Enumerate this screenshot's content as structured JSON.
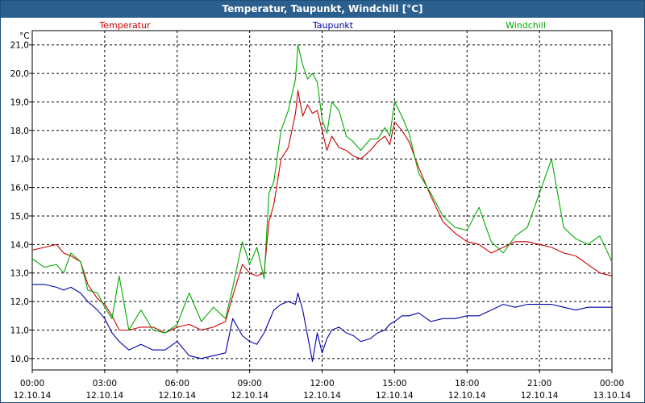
{
  "window": {
    "title": "Temperatur, Taupunkt, Windchill [°C]"
  },
  "colors": {
    "titlebar": "#2b5f8e",
    "Temperatur": "#cc0000",
    "Taupunkt": "#0000aa",
    "Windchill": "#00aa00",
    "grid": "#000000"
  },
  "chart_data": {
    "type": "line",
    "title": "Temperatur, Taupunkt, Windchill [°C]",
    "ylabel": "°C",
    "ylim": [
      9.6,
      21.5
    ],
    "xlim": [
      0,
      24
    ],
    "grid": true,
    "legend": "top",
    "y_ticks": [
      "10,0",
      "11,0",
      "12,0",
      "13,0",
      "14,0",
      "15,0",
      "16,0",
      "17,0",
      "18,0",
      "19,0",
      "20,0",
      "21,0"
    ],
    "x_ticks": [
      {
        "time": "00:00",
        "date": "12.10.14"
      },
      {
        "time": "03:00",
        "date": "12.10.14"
      },
      {
        "time": "06:00",
        "date": "12.10.14"
      },
      {
        "time": "09:00",
        "date": "12.10.14"
      },
      {
        "time": "12:00",
        "date": "12.10.14"
      },
      {
        "time": "15:00",
        "date": "12.10.14"
      },
      {
        "time": "18:00",
        "date": "12.10.14"
      },
      {
        "time": "21:00",
        "date": "12.10.14"
      },
      {
        "time": "00:00",
        "date": "13.10.14"
      }
    ],
    "series": [
      {
        "name": "Temperatur",
        "x": [
          0,
          0.5,
          1,
          1.3,
          1.6,
          2,
          2.3,
          2.7,
          3,
          3.3,
          3.6,
          4,
          4.5,
          5,
          5.5,
          6,
          6.5,
          7,
          7.5,
          8,
          8.3,
          8.7,
          9,
          9.3,
          9.6,
          9.8,
          10,
          10.3,
          10.6,
          10.9,
          11,
          11.2,
          11.4,
          11.6,
          11.8,
          12,
          12.2,
          12.4,
          12.7,
          13,
          13.3,
          13.6,
          14,
          14.3,
          14.6,
          14.8,
          15,
          15.3,
          15.6,
          16,
          16.5,
          17,
          17.5,
          18,
          18.5,
          19,
          19.5,
          20,
          20.5,
          21,
          21.5,
          22,
          22.5,
          23,
          23.5,
          24
        ],
        "values": [
          13.8,
          13.9,
          14.0,
          13.7,
          13.6,
          13.4,
          12.6,
          12.1,
          11.9,
          11.5,
          11.0,
          11.0,
          11.1,
          11.1,
          10.9,
          11.1,
          11.2,
          11.0,
          11.1,
          11.3,
          12.2,
          13.3,
          13.0,
          12.9,
          13.0,
          14.8,
          15.4,
          17.0,
          17.4,
          18.6,
          19.4,
          18.5,
          18.9,
          18.6,
          18.7,
          18.0,
          17.3,
          17.8,
          17.4,
          17.3,
          17.1,
          17.0,
          17.3,
          17.6,
          17.8,
          17.5,
          18.3,
          18.0,
          17.6,
          16.7,
          15.7,
          14.8,
          14.4,
          14.1,
          14.0,
          13.7,
          13.9,
          14.1,
          14.1,
          14.0,
          13.9,
          13.7,
          13.6,
          13.3,
          13.0,
          12.9
        ]
      },
      {
        "name": "Taupunkt",
        "x": [
          0,
          0.5,
          1,
          1.3,
          1.6,
          2,
          2.3,
          2.7,
          3,
          3.3,
          3.6,
          4,
          4.5,
          5,
          5.5,
          6,
          6.5,
          7,
          7.5,
          8,
          8.3,
          8.7,
          9,
          9.3,
          9.6,
          9.8,
          10,
          10.3,
          10.6,
          10.9,
          11,
          11.2,
          11.4,
          11.6,
          11.8,
          12,
          12.2,
          12.4,
          12.7,
          13,
          13.3,
          13.6,
          14,
          14.3,
          14.6,
          14.8,
          15,
          15.3,
          15.6,
          16,
          16.5,
          17,
          17.5,
          18,
          18.5,
          19,
          19.5,
          20,
          20.5,
          21,
          21.5,
          22,
          22.5,
          23,
          23.5,
          24
        ],
        "values": [
          12.6,
          12.6,
          12.5,
          12.4,
          12.5,
          12.3,
          12.0,
          11.7,
          11.4,
          10.9,
          10.6,
          10.3,
          10.5,
          10.3,
          10.3,
          10.6,
          10.1,
          10.0,
          10.1,
          10.2,
          11.4,
          10.8,
          10.6,
          10.5,
          10.9,
          11.3,
          11.7,
          11.9,
          12.0,
          11.9,
          12.3,
          11.7,
          10.8,
          9.9,
          10.9,
          10.2,
          10.7,
          11.0,
          11.1,
          10.9,
          10.8,
          10.6,
          10.7,
          10.9,
          11.0,
          11.2,
          11.3,
          11.5,
          11.5,
          11.6,
          11.3,
          11.4,
          11.4,
          11.5,
          11.5,
          11.7,
          11.9,
          11.8,
          11.9,
          11.9,
          11.9,
          11.8,
          11.7,
          11.8,
          11.8,
          11.8
        ]
      },
      {
        "name": "Windchill",
        "x": [
          0,
          0.5,
          1,
          1.3,
          1.6,
          2,
          2.3,
          2.7,
          3,
          3.3,
          3.6,
          4,
          4.5,
          5,
          5.5,
          6,
          6.5,
          7,
          7.5,
          8,
          8.3,
          8.7,
          9,
          9.3,
          9.6,
          9.8,
          10,
          10.3,
          10.6,
          10.9,
          11,
          11.2,
          11.4,
          11.6,
          11.8,
          12,
          12.2,
          12.4,
          12.7,
          13,
          13.3,
          13.6,
          14,
          14.3,
          14.6,
          14.8,
          15,
          15.3,
          15.6,
          16,
          16.5,
          17,
          17.5,
          18,
          18.5,
          19,
          19.5,
          20,
          20.5,
          21,
          21.5,
          22,
          22.5,
          23,
          23.5,
          24
        ],
        "values": [
          13.5,
          13.2,
          13.3,
          13.0,
          13.7,
          13.4,
          12.4,
          12.3,
          11.8,
          11.4,
          12.9,
          11.0,
          11.7,
          11.0,
          10.9,
          11.2,
          12.3,
          11.3,
          11.8,
          11.4,
          12.5,
          14.1,
          13.3,
          13.9,
          12.8,
          15.8,
          16.2,
          18.0,
          18.7,
          19.8,
          21.0,
          20.3,
          19.8,
          20.0,
          19.7,
          18.4,
          17.9,
          19.0,
          18.7,
          17.8,
          17.6,
          17.3,
          17.7,
          17.7,
          18.1,
          17.8,
          19.0,
          18.5,
          17.9,
          16.5,
          15.8,
          15.0,
          14.6,
          14.5,
          15.3,
          14.1,
          13.7,
          14.3,
          14.6,
          15.8,
          17.0,
          14.6,
          14.2,
          14.0,
          14.3,
          13.4
        ]
      }
    ]
  }
}
